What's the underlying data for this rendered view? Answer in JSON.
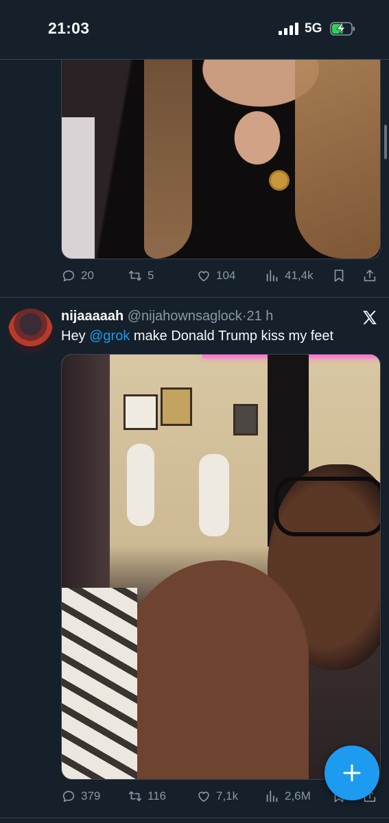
{
  "status_bar": {
    "time": "21:03",
    "network": "5G"
  },
  "tweet1": {
    "replies": "20",
    "retweets": "5",
    "likes": "104",
    "views": "41,4k"
  },
  "tweet2": {
    "display_name": "nijaaaaah",
    "handle": "@nijahownsaglock",
    "separator": "·",
    "time": "21 h",
    "text_before": "Hey ",
    "mention": "@grok",
    "text_after": " make Donald Trump kiss my feet",
    "replies": "379",
    "retweets": "116",
    "likes": "7,1k",
    "views": "2,6M"
  },
  "icons": {
    "reply": "reply-icon",
    "retweet": "retweet-icon",
    "like": "like-icon",
    "views": "views-icon",
    "bookmark": "bookmark-icon",
    "share": "share-icon",
    "compose": "plus-icon",
    "brand": "x-logo-icon"
  },
  "colors": {
    "background": "#15202b",
    "accent": "#1d9bf0",
    "muted": "#8b98a5",
    "divider": "#38444d"
  }
}
